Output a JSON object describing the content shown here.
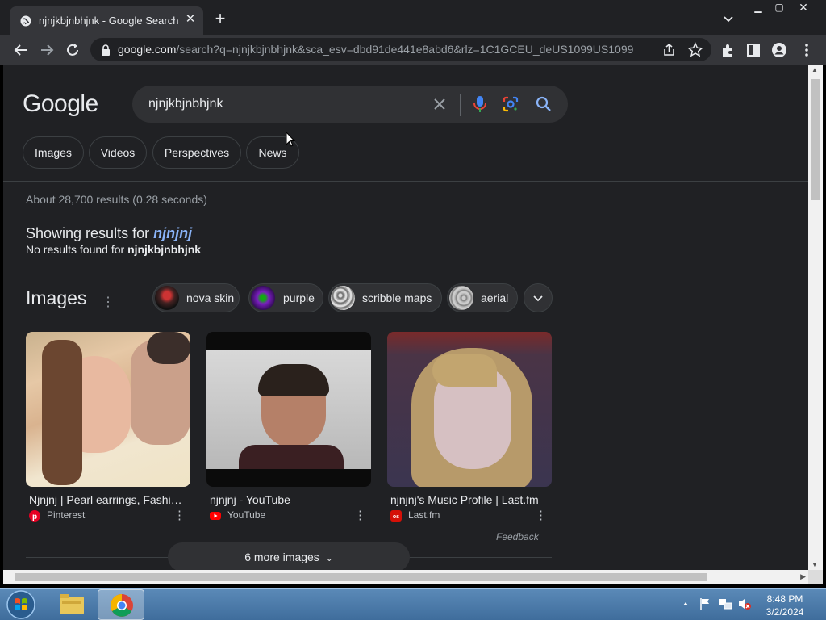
{
  "browser": {
    "tab_title": "njnjkbjnbhjnk - Google Search",
    "url_domain": "google.com",
    "url_path": "/search?q=njnjkbjnbhjnk&sca_esv=dbd91de441e8abd6&rlz=1C1GCEU_deUS1099US1099"
  },
  "search": {
    "logo": "Google",
    "query": "njnjkbjnbhjnk"
  },
  "tabs": [
    "Images",
    "Videos",
    "Perspectives",
    "News"
  ],
  "results": {
    "stats": "About 28,700 results (0.28 seconds)",
    "showing_prefix": "Showing results for ",
    "showing_term": "njnjnj",
    "nofound_prefix": "No results found for ",
    "nofound_term": "njnjkbjnbhjnk"
  },
  "images": {
    "title": "Images",
    "filters": [
      "nova skin",
      "purple",
      "scribble maps",
      "aerial"
    ],
    "cards": [
      {
        "caption": "Njnjnj | Pearl earrings, Fashion...",
        "source": "Pinterest"
      },
      {
        "caption": "njnjnj - YouTube",
        "source": "YouTube"
      },
      {
        "caption": "njnjnj's Music Profile | Last.fm",
        "source": "Last.fm"
      }
    ],
    "feedback": "Feedback",
    "more_label": "6 more images"
  },
  "taskbar": {
    "time": "8:48 PM",
    "date": "3/2/2024"
  },
  "colors": {
    "accent_link": "#8ab4f8",
    "page_bg": "#202124"
  }
}
